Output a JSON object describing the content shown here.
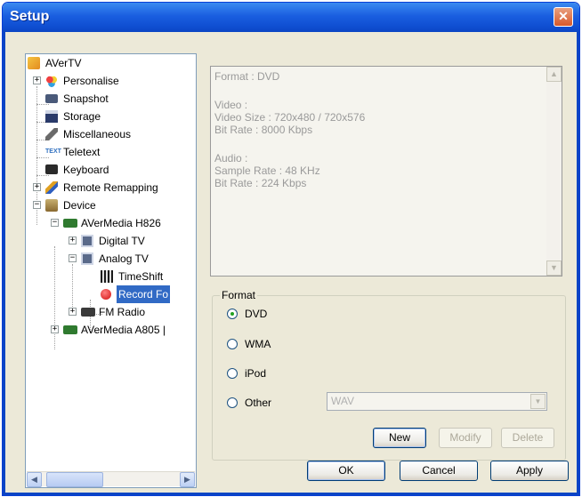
{
  "window": {
    "title": "Setup"
  },
  "tree": {
    "root": "AVerTV",
    "personalise": "Personalise",
    "snapshot": "Snapshot",
    "storage": "Storage",
    "miscellaneous": "Miscellaneous",
    "teletext": "Teletext",
    "teletext_icon_text": "TEXT",
    "keyboard": "Keyboard",
    "remote_remapping": "Remote Remapping",
    "device": "Device",
    "avermedia_h826": "AVerMedia H826",
    "digital_tv": "Digital TV",
    "analog_tv": "Analog TV",
    "timeshift": "TimeShift",
    "record_format": "Record Fo",
    "fm_radio": "FM Radio",
    "avermedia_a805": "AVerMedia A805 |"
  },
  "info": {
    "format_line": "Format : DVD",
    "video_header": "Video :",
    "video_size": "Video Size : 720x480 / 720x576",
    "video_bitrate": "Bit Rate : 8000 Kbps",
    "audio_header": "Audio :",
    "sample_rate": "Sample Rate : 48 KHz",
    "audio_bitrate": "Bit Rate : 224 Kbps"
  },
  "format": {
    "legend": "Format",
    "options": [
      "DVD",
      "WMA",
      "iPod",
      "Other"
    ],
    "selected": "DVD",
    "other_combo_value": "WAV"
  },
  "buttons": {
    "new": "New",
    "modify": "Modify",
    "delete": "Delete",
    "ok": "OK",
    "cancel": "Cancel",
    "apply": "Apply"
  }
}
